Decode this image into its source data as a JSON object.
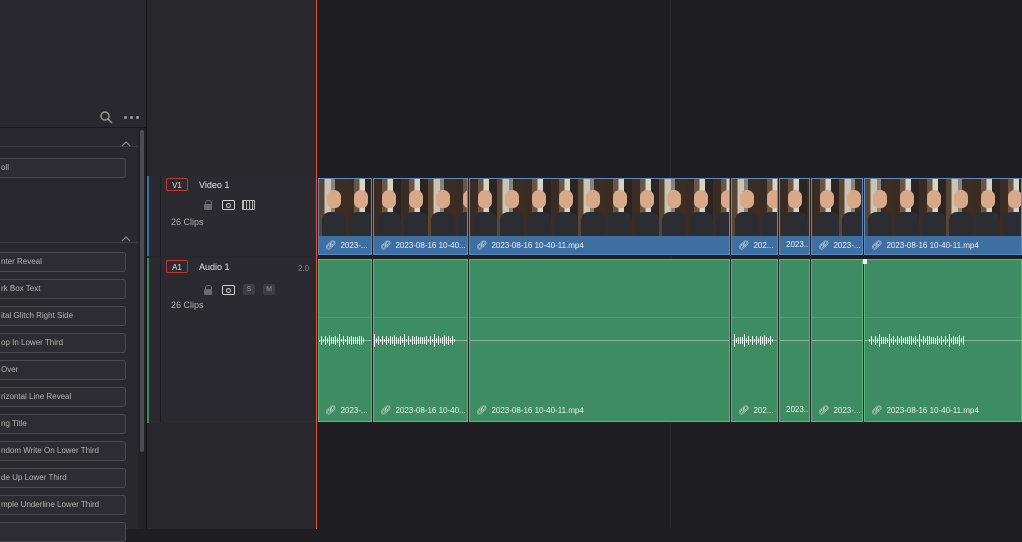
{
  "effects": {
    "items": [
      {
        "label": "oll"
      },
      {
        "label": "nter Reveal"
      },
      {
        "label": "rk Box Text"
      },
      {
        "label": "ital Glitch Right Side"
      },
      {
        "label": "op In Lower Third"
      },
      {
        "label": "Over"
      },
      {
        "label": "rizontal Line Reveal"
      },
      {
        "label": "ng Title"
      },
      {
        "label": "ndom Write On Lower Third"
      },
      {
        "label": "de Up Lower Third"
      },
      {
        "label": "mple Underline Lower Third"
      }
    ]
  },
  "tracks": {
    "video": {
      "id": "V1",
      "name": "Video 1",
      "clip_count": "26 Clips"
    },
    "audio": {
      "id": "A1",
      "name": "Audio 1",
      "channels": "2.0",
      "clip_count": "26 Clips",
      "solo_label": "S",
      "mute_label": "M"
    }
  },
  "clips": [
    {
      "label": "2023-..."
    },
    {
      "label": "2023-08-16 10-40..."
    },
    {
      "label": "2023-08-16 10-40-11.mp4"
    },
    {
      "label": "202..."
    },
    {
      "label": "2023..."
    },
    {
      "label": "2023-..."
    },
    {
      "label": "2023-08-16 10-40-11.mp4"
    }
  ],
  "colors": {
    "video_clip": "#3e6fa2",
    "audio_clip": "#3e8c61",
    "playhead": "#e0533c",
    "record_arm": "#c0392b"
  }
}
